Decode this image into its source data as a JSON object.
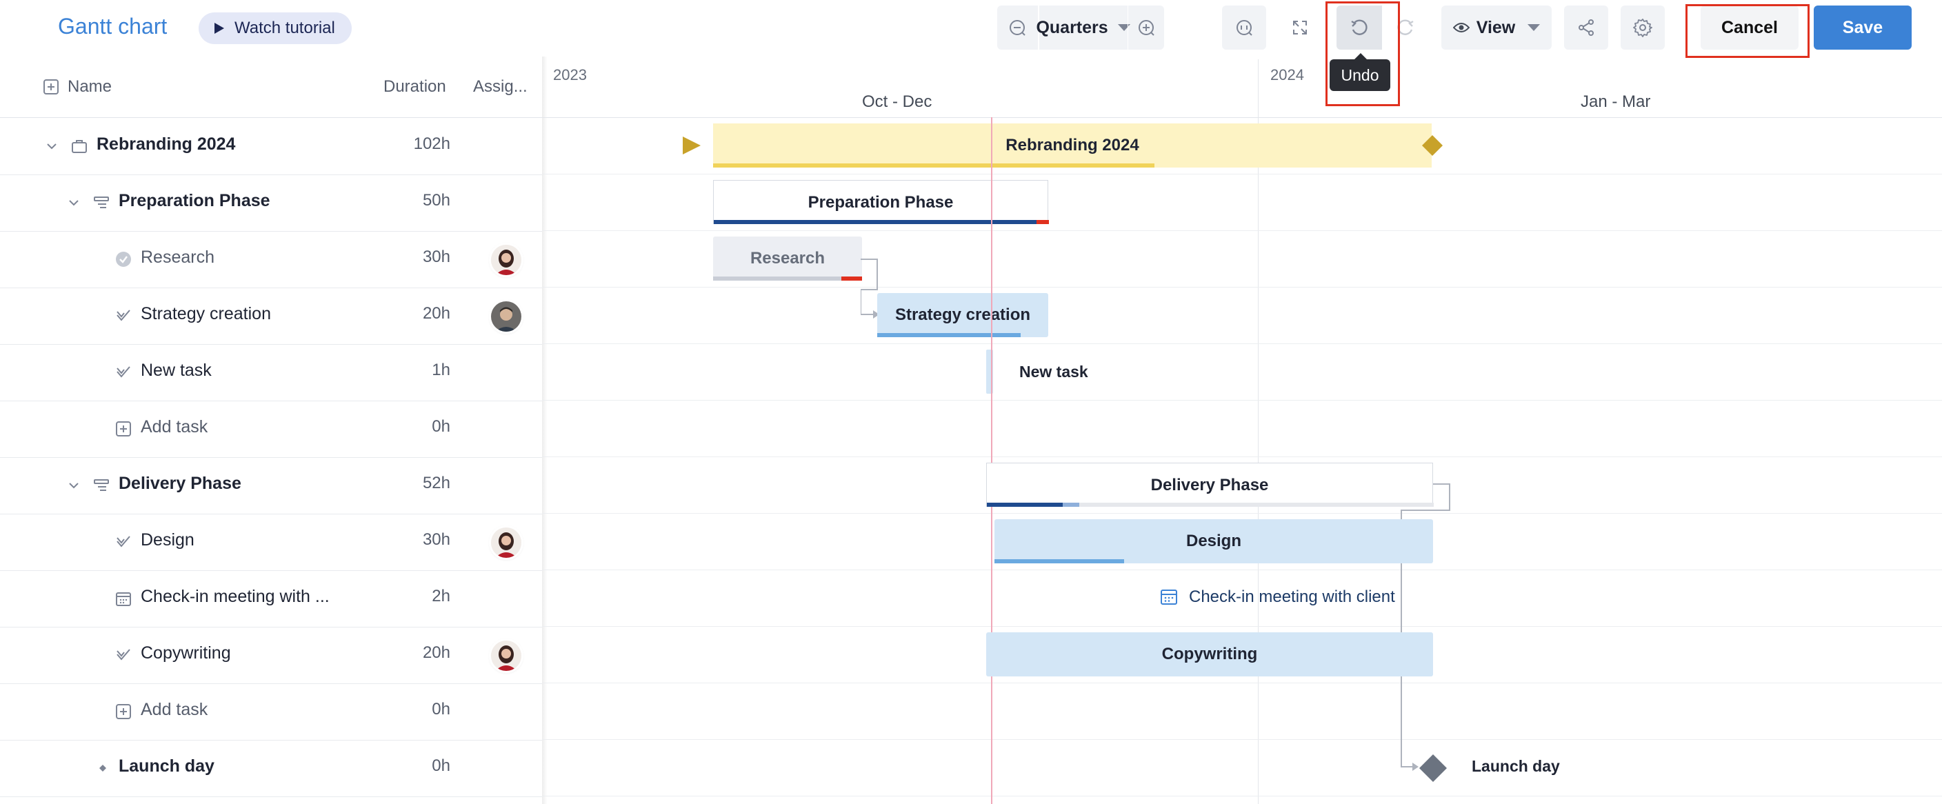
{
  "header": {
    "title": "Gantt chart",
    "tutorial_label": "Watch tutorial",
    "zoom_label": "Quarters",
    "view_label": "View",
    "cancel_label": "Cancel",
    "save_label": "Save",
    "undo_tooltip": "Undo"
  },
  "columns": {
    "name": "Name",
    "duration": "Duration",
    "assignee": "Assig..."
  },
  "timeline": {
    "years": [
      "2023",
      "2024"
    ],
    "quarters": [
      "Oct - Dec",
      "Jan - Mar"
    ]
  },
  "rows": [
    {
      "name": "Rebranding 2024",
      "duration": "102h"
    },
    {
      "name": "Preparation Phase",
      "duration": "50h"
    },
    {
      "name": "Research",
      "duration": "30h"
    },
    {
      "name": "Strategy creation",
      "duration": "20h"
    },
    {
      "name": "New task",
      "duration": "1h"
    },
    {
      "name": "Add task",
      "duration": "0h"
    },
    {
      "name": "Delivery Phase",
      "duration": "52h"
    },
    {
      "name": "Design",
      "duration": "30h"
    },
    {
      "name": "Check-in meeting with ...",
      "duration": "2h"
    },
    {
      "name": "Copywriting",
      "duration": "20h"
    },
    {
      "name": "Add task",
      "duration": "0h"
    },
    {
      "name": "Launch day",
      "duration": "0h"
    }
  ],
  "bars": {
    "rebranding": "Rebranding 2024",
    "preparation": "Preparation Phase",
    "research": "Research",
    "strategy": "Strategy creation",
    "new_task": "New task",
    "delivery": "Delivery Phase",
    "design": "Design",
    "checkin": "Check-in meeting with client",
    "copywriting": "Copywriting",
    "launch": "Launch day"
  },
  "colors": {
    "accent": "#3b82d6",
    "project_bar": "#fdf3c4",
    "task_bar": "#d3e6f6",
    "highlight": "#e0301e"
  }
}
